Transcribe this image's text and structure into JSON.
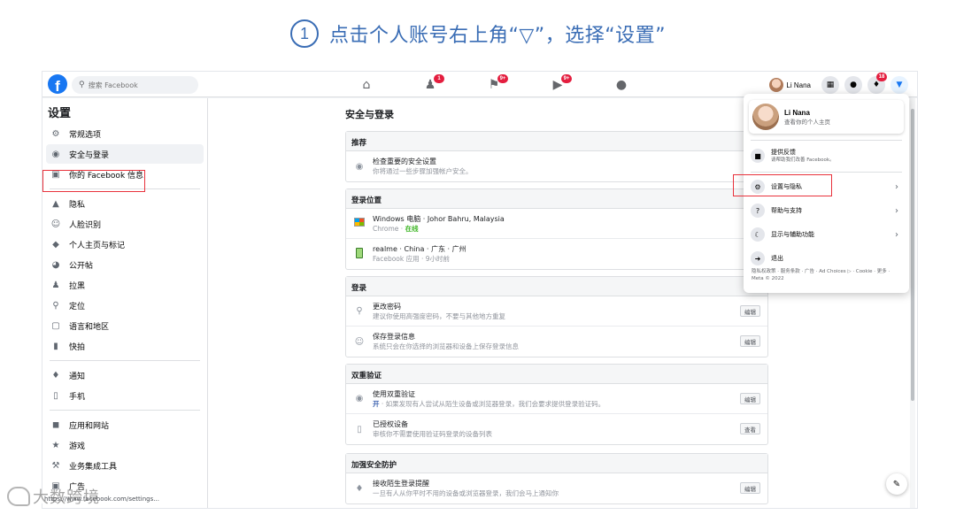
{
  "instruction": {
    "step_number": "1",
    "text": "点击个人账号右上角“▽”，选择“设置”"
  },
  "topnav": {
    "search_placeholder": "搜索 Facebook",
    "badges": {
      "friends": "1",
      "pages": "9+",
      "watch": "9+",
      "notifications": "18"
    },
    "user_name": "Li Nana"
  },
  "sidebar": {
    "title": "设置",
    "groups": [
      [
        {
          "icon": "gear-icon",
          "label": "常规选项"
        },
        {
          "icon": "shield-icon",
          "label": "安全与登录"
        },
        {
          "icon": "facebook-info-icon",
          "label": "你的 Facebook 信息"
        }
      ],
      [
        {
          "icon": "lock-icon",
          "label": "隐私"
        },
        {
          "icon": "face-recognition-icon",
          "label": "人脸识别"
        },
        {
          "icon": "profile-tag-icon",
          "label": "个人主页与标记"
        },
        {
          "icon": "globe-icon",
          "label": "公开帖"
        },
        {
          "icon": "block-icon",
          "label": "拉黑"
        },
        {
          "icon": "location-icon",
          "label": "定位"
        },
        {
          "icon": "language-icon",
          "label": "语言和地区"
        },
        {
          "icon": "story-icon",
          "label": "快拍"
        }
      ],
      [
        {
          "icon": "notification-icon",
          "label": "通知"
        },
        {
          "icon": "mobile-icon",
          "label": "手机"
        }
      ],
      [
        {
          "icon": "apps-icon",
          "label": "应用和网站"
        },
        {
          "icon": "game-icon",
          "label": "游戏"
        },
        {
          "icon": "business-tools-icon",
          "label": "业务集成工具"
        },
        {
          "icon": "ads-icon",
          "label": "广告"
        }
      ]
    ]
  },
  "main": {
    "title": "安全与登录",
    "sections": {
      "recommended": {
        "header": "推荐",
        "row": {
          "title": "检查重要的安全设置",
          "desc": "你将通过一些步骤加强帐户安全。"
        }
      },
      "login_locations": {
        "header": "登录位置",
        "windows": {
          "title": "Windows 电脑 · Johor Bahru, Malaysia",
          "browser": "Chrome ·",
          "status": "在线"
        },
        "realme": {
          "title": "realme · China · 广东 · 广州",
          "desc": "Facebook 应用 · 9小时前"
        }
      },
      "login": {
        "header": "登录",
        "change_password": {
          "title": "更改密码",
          "desc": "建议你使用高强度密码，不要与其他地方重复",
          "button": "编辑"
        },
        "save_login": {
          "title": "保存登录信息",
          "desc": "系统只会在你选择的浏览器和设备上保存登录信息",
          "button": "编辑"
        }
      },
      "two_factor": {
        "header": "双重验证",
        "use_2fa": {
          "title": "使用双重验证",
          "status": "开",
          "desc": " · 如果发现有人尝试从陌生设备或浏览器登录，我们会要求提供登录验证码。",
          "button": "编辑"
        },
        "authorized": {
          "title": "已授权设备",
          "desc": "审核你不需要使用验证码登录的设备列表",
          "button": "查看"
        }
      },
      "extra_security": {
        "header": "加强安全防护",
        "alerts": {
          "title": "接收陌生登录提醒",
          "desc": "一旦有人从你平时不用的设备或浏览器登录，我们会马上通知你",
          "button": "编辑"
        }
      }
    }
  },
  "dropdown": {
    "profile_name": "Li Nana",
    "profile_sub": "查看你的个人主页",
    "feedback_title": "提供反馈",
    "feedback_sub": "请帮助我们改善 Facebook。",
    "items": [
      {
        "icon": "gear-icon",
        "label": "设置与隐私"
      },
      {
        "icon": "help-icon",
        "label": "帮助与支持"
      },
      {
        "icon": "moon-icon",
        "label": "显示与辅助功能"
      },
      {
        "icon": "logout-icon",
        "label": "退出"
      }
    ],
    "footer": "隐私权政策 · 服务条款 · 广告 · Ad Choices ▷ · Cookie · 更多 · Meta © 2022"
  },
  "url_hint": "https://www.facebook.com/settings...",
  "watermark": "大数跨境",
  "colors": {
    "accent": "#1877f2",
    "instruction": "#3a6db5",
    "highlight": "#e8323c",
    "online": "#42b72a",
    "badge": "#e41e3f"
  }
}
